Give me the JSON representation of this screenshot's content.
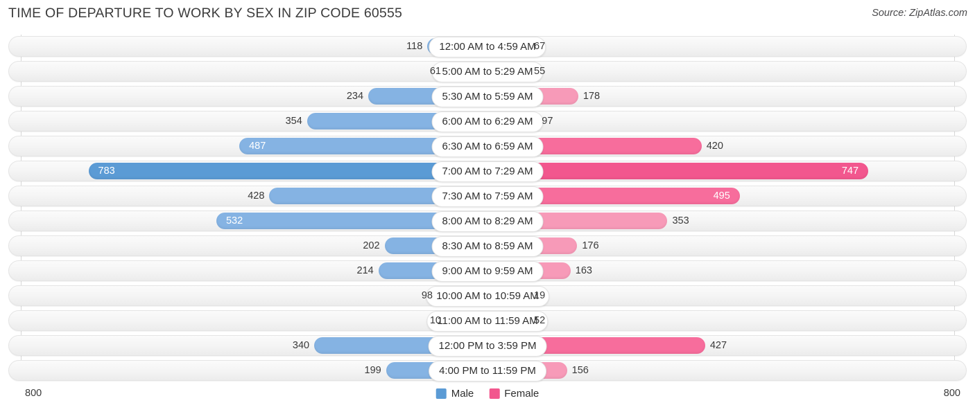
{
  "header": {
    "title": "TIME OF DEPARTURE TO WORK BY SEX IN ZIP CODE 60555",
    "source": "Source: ZipAtlas.com"
  },
  "legend": {
    "male_label": "Male",
    "female_label": "Female",
    "male_color": "#5b9bd5",
    "female_color": "#f2578e"
  },
  "axis": {
    "left_min": "800",
    "right_min": "800",
    "max": 800
  },
  "chart_data": {
    "type": "bar",
    "orientation": "horizontal-diverging",
    "title": "TIME OF DEPARTURE TO WORK BY SEX IN ZIP CODE 60555",
    "xlabel": "",
    "ylabel": "",
    "xlim": [
      0,
      800
    ],
    "grid": true,
    "legend_position": "bottom-center",
    "categories": [
      "12:00 AM to 4:59 AM",
      "5:00 AM to 5:29 AM",
      "5:30 AM to 5:59 AM",
      "6:00 AM to 6:29 AM",
      "6:30 AM to 6:59 AM",
      "7:00 AM to 7:29 AM",
      "7:30 AM to 7:59 AM",
      "8:00 AM to 8:29 AM",
      "8:30 AM to 8:59 AM",
      "9:00 AM to 9:59 AM",
      "10:00 AM to 10:59 AM",
      "11:00 AM to 11:59 AM",
      "12:00 PM to 3:59 PM",
      "4:00 PM to 11:59 PM"
    ],
    "series": [
      {
        "name": "Male",
        "values": [
          118,
          61,
          234,
          354,
          487,
          783,
          428,
          532,
          202,
          214,
          98,
          10,
          340,
          199
        ]
      },
      {
        "name": "Female",
        "values": [
          67,
          55,
          178,
          97,
          420,
          747,
          495,
          353,
          176,
          163,
          19,
          52,
          427,
          156
        ]
      }
    ]
  },
  "rows": [
    {
      "label": "12:00 AM to 4:59 AM",
      "male": "118",
      "female": "67",
      "male_in": false,
      "female_in": false,
      "male_peak": false,
      "female_tone": "base"
    },
    {
      "label": "5:00 AM to 5:29 AM",
      "male": "61",
      "female": "55",
      "male_in": false,
      "female_in": false,
      "male_peak": false,
      "female_tone": "base"
    },
    {
      "label": "5:30 AM to 5:59 AM",
      "male": "234",
      "female": "178",
      "male_in": false,
      "female_in": false,
      "male_peak": false,
      "female_tone": "base"
    },
    {
      "label": "6:00 AM to 6:29 AM",
      "male": "354",
      "female": "97",
      "male_in": false,
      "female_in": false,
      "male_peak": false,
      "female_tone": "base"
    },
    {
      "label": "6:30 AM to 6:59 AM",
      "male": "487",
      "female": "420",
      "male_in": true,
      "female_in": false,
      "male_peak": false,
      "female_tone": "hi"
    },
    {
      "label": "7:00 AM to 7:29 AM",
      "male": "783",
      "female": "747",
      "male_in": true,
      "female_in": true,
      "male_peak": true,
      "female_tone": "peak"
    },
    {
      "label": "7:30 AM to 7:59 AM",
      "male": "428",
      "female": "495",
      "male_in": false,
      "female_in": true,
      "male_peak": false,
      "female_tone": "hi"
    },
    {
      "label": "8:00 AM to 8:29 AM",
      "male": "532",
      "female": "353",
      "male_in": true,
      "female_in": false,
      "male_peak": false,
      "female_tone": "base"
    },
    {
      "label": "8:30 AM to 8:59 AM",
      "male": "202",
      "female": "176",
      "male_in": false,
      "female_in": false,
      "male_peak": false,
      "female_tone": "base"
    },
    {
      "label": "9:00 AM to 9:59 AM",
      "male": "214",
      "female": "163",
      "male_in": false,
      "female_in": false,
      "male_peak": false,
      "female_tone": "base"
    },
    {
      "label": "10:00 AM to 10:59 AM",
      "male": "98",
      "female": "19",
      "male_in": false,
      "female_in": false,
      "male_peak": false,
      "female_tone": "base"
    },
    {
      "label": "11:00 AM to 11:59 AM",
      "male": "10",
      "female": "52",
      "male_in": false,
      "female_in": false,
      "male_peak": false,
      "female_tone": "base"
    },
    {
      "label": "12:00 PM to 3:59 PM",
      "male": "340",
      "female": "427",
      "male_in": false,
      "female_in": false,
      "male_peak": false,
      "female_tone": "hi"
    },
    {
      "label": "4:00 PM to 11:59 PM",
      "male": "199",
      "female": "156",
      "male_in": false,
      "female_in": false,
      "male_peak": false,
      "female_tone": "base"
    }
  ]
}
